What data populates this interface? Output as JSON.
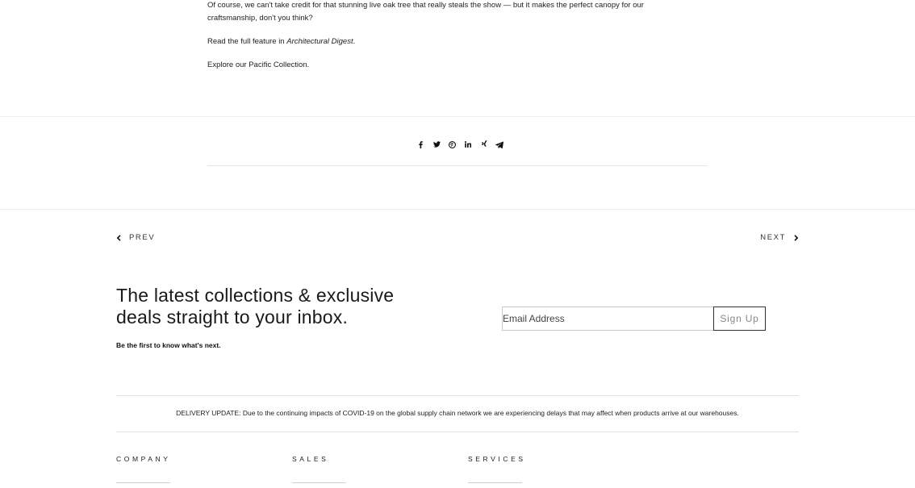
{
  "article": {
    "paragraph1": "Of course, we can't take credit for that stunning live oak tree that really steals the show — but it makes the perfect canopy for our craftsmanship, don't you think?",
    "read_prefix": "Read the full feature in ",
    "read_link": "Architectural Digest",
    "read_suffix": ".",
    "explore_text": "Explore our Pacific Collection."
  },
  "share": {
    "icons": [
      "facebook-icon",
      "twitter-icon",
      "pinterest-icon",
      "linkedin-icon",
      "xing-icon",
      "telegram-icon"
    ]
  },
  "pager": {
    "prev_label": "PREV",
    "next_label": "NEXT"
  },
  "newsletter": {
    "heading": "The latest collections & exclusive deals straight to your inbox.",
    "subtext": "Be the first to know what's next.",
    "email_placeholder": "Email Address",
    "signup_label": "Sign Up"
  },
  "delivery": {
    "text": "DELIVERY UPDATE: Due to the continuing impacts of COVID-19 on the global supply chain network we are experiencing delays that may affect when products arrive at our warehouses."
  },
  "footer": {
    "columns": [
      "COMPANY",
      "SALES",
      "SERVICES"
    ]
  }
}
